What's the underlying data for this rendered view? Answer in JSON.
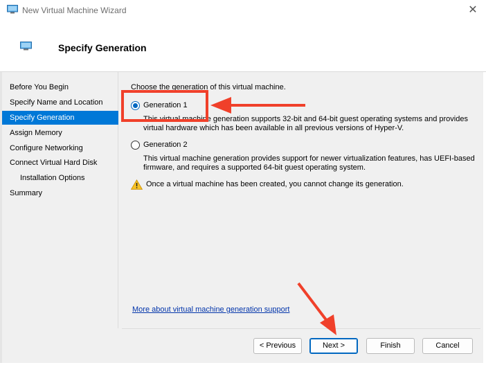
{
  "window": {
    "title": "New Virtual Machine Wizard",
    "close_glyph": "✕",
    "icon": "vm-monitor-icon"
  },
  "header": {
    "title": "Specify Generation",
    "icon": "vm-monitor-icon"
  },
  "nav": {
    "items": [
      {
        "label": "Before You Begin",
        "selected": false,
        "indent": false
      },
      {
        "label": "Specify Name and Location",
        "selected": false,
        "indent": false
      },
      {
        "label": "Specify Generation",
        "selected": true,
        "indent": false
      },
      {
        "label": "Assign Memory",
        "selected": false,
        "indent": false
      },
      {
        "label": "Configure Networking",
        "selected": false,
        "indent": false
      },
      {
        "label": "Connect Virtual Hard Disk",
        "selected": false,
        "indent": false
      },
      {
        "label": "Installation Options",
        "selected": false,
        "indent": true
      },
      {
        "label": "Summary",
        "selected": false,
        "indent": false
      }
    ]
  },
  "content": {
    "prompt": "Choose the generation of this virtual machine.",
    "options": [
      {
        "label": "Generation 1",
        "checked": true,
        "description": "This virtual machine generation supports 32-bit and 64-bit guest operating systems and provides virtual hardware which has been available in all previous versions of Hyper-V."
      },
      {
        "label": "Generation 2",
        "checked": false,
        "description": "This virtual machine generation provides support for newer virtualization features, has UEFI-based firmware, and requires a supported 64-bit guest operating system."
      }
    ],
    "warning": "Once a virtual machine has been created, you cannot change its generation.",
    "warning_icon": "warning-icon",
    "more_link": "More about virtual machine generation support"
  },
  "buttons": {
    "previous": "< Previous",
    "next": "Next >",
    "finish": "Finish",
    "cancel": "Cancel"
  },
  "colors": {
    "selection": "#0078d7",
    "radio_accent": "#0067c0",
    "annotation": "#f0402a",
    "link": "#0033aa"
  }
}
